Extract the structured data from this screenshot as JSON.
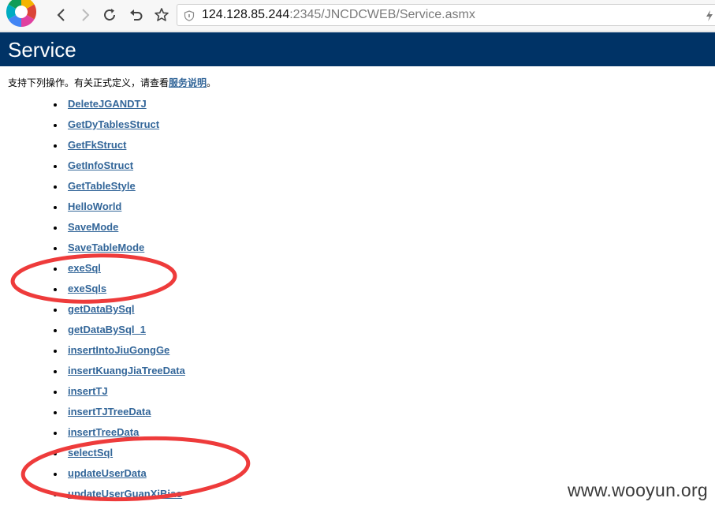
{
  "browser": {
    "logo_icon": "browser-logo-icon",
    "back_icon": "back-arrow-icon",
    "forward_icon": "forward-arrow-icon",
    "reload_icon": "reload-icon",
    "undo_icon": "undo-icon",
    "bookmark_icon": "star-icon",
    "security_icon": "shield-icon",
    "url_host": "124.128.85.244",
    "url_path": ":2345/JNCDCWEB/Service.asmx"
  },
  "page": {
    "title": "Service",
    "intro_prefix": "支持下列操作。有关正式定义，请查看",
    "intro_link": "服务说明",
    "intro_suffix": "。",
    "operations": [
      "DeleteJGANDTJ",
      "GetDyTablesStruct",
      "GetFkStruct",
      "GetInfoStruct",
      "GetTableStyle",
      "HelloWorld",
      "SaveMode",
      "SaveTableMode",
      "exeSql",
      "exeSqls",
      "getDataBySql",
      "getDataBySql_1",
      "insertIntoJiuGongGe",
      "insertKuangJiaTreeData",
      "insertTJ",
      "insertTJTreeData",
      "insertTreeData",
      "selectSql",
      "updateUserData",
      "updateUserGuanXiBiao"
    ]
  },
  "colors": {
    "header_bar": "#003366",
    "link": "#336699",
    "annotation_circle": "#ee3b3b"
  },
  "watermark": "www.wooyun.org"
}
